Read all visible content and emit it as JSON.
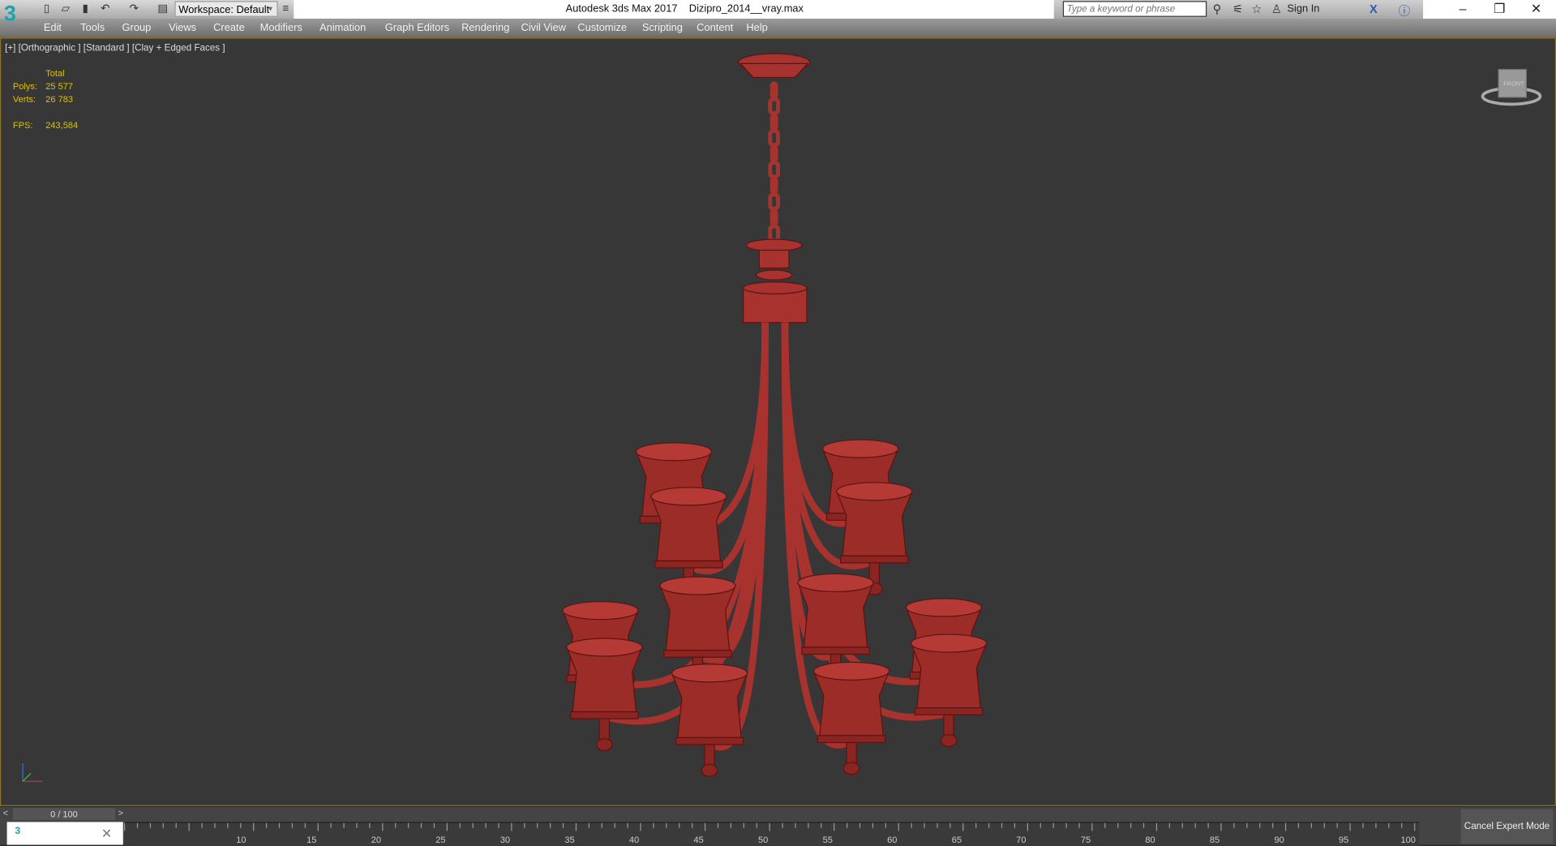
{
  "app": {
    "logo": "3",
    "title": "Autodesk 3ds Max 2017",
    "file": "Dizipro_2014__vray.max"
  },
  "toolbar": {
    "workspace": "Workspace: Default",
    "icons": [
      "new-icon",
      "open-icon",
      "save-icon",
      "undo-icon",
      "redo-icon",
      "project-icon"
    ]
  },
  "search": {
    "placeholder": "Type a keyword or phrase",
    "sign_in": "Sign In"
  },
  "menu": [
    "Edit",
    "Tools",
    "Group",
    "Views",
    "Create",
    "Modifiers",
    "Animation",
    "Graph Editors",
    "Rendering",
    "Civil View",
    "Customize",
    "Scripting",
    "Content",
    "Help"
  ],
  "viewport": {
    "label": "[+] [Orthographic ] [Standard ] [Clay + Edged Faces ]",
    "stats": {
      "header": "Total",
      "polys_label": "Polys:",
      "polys": "25 577",
      "verts_label": "Verts:",
      "verts": "26 783",
      "fps_label": "FPS:",
      "fps": "243,584"
    },
    "viewcube": "FRONT"
  },
  "timeline": {
    "frame": "0 / 100",
    "ticks": [
      "10",
      "15",
      "20",
      "25",
      "30",
      "35",
      "40",
      "45",
      "50",
      "55",
      "60",
      "65",
      "70",
      "75",
      "80",
      "85",
      "90",
      "95",
      "100"
    ]
  },
  "cancel_expert": "Cancel Expert Mode",
  "colors": {
    "accent": "#8a7326",
    "stats": "#e2c100",
    "model": "#a8322e"
  }
}
